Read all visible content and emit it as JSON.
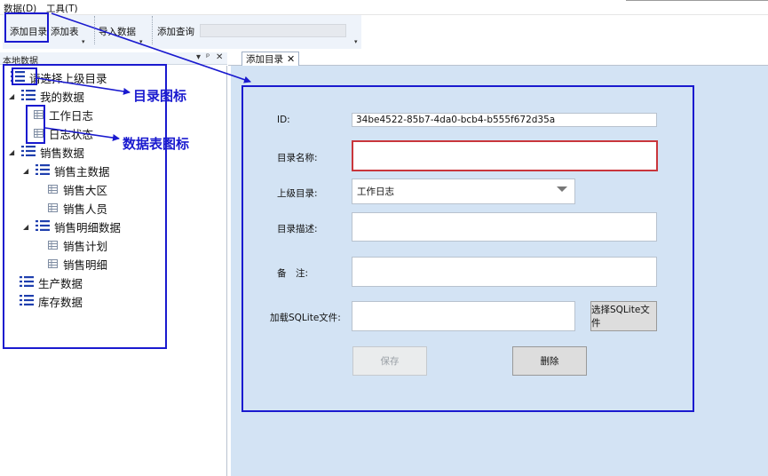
{
  "menu": {
    "items": [
      "数据(D)",
      "工具(T)"
    ]
  },
  "toolbar": {
    "add_directory": "添加目录",
    "add_table": "添加表",
    "import_data": "导入数据",
    "add_query": "添加查询"
  },
  "left_panel": {
    "title": "本地数据",
    "controls": [
      "▾",
      "ᵖ",
      "✕"
    ],
    "tree": {
      "root": "请选择上级目录",
      "my_data": "我的数据",
      "work_log": "工作日志",
      "log_status": "日志状态",
      "sales_data": "销售数据",
      "sales_master": "销售主数据",
      "sales_region": "销售大区",
      "sales_staff": "销售人员",
      "sales_detail_data": "销售明细数据",
      "sales_plan": "销售计划",
      "sales_detail": "销售明细",
      "production_data": "生产数据",
      "inventory_data": "库存数据"
    }
  },
  "annotations": {
    "directory_icon": "目录图标",
    "table_icon": "数据表图标"
  },
  "tab": {
    "label": "添加目录",
    "close": "✕"
  },
  "form": {
    "id_label": "ID:",
    "id_value": "34be4522-85b7-4da0-bcb4-b555f672d35a",
    "name_label": "目录名称:",
    "name_value": "",
    "parent_label": "上级目录:",
    "parent_value": "工作日志",
    "desc_label": "目录描述:",
    "desc_value": "",
    "note_label": "备　注:",
    "note_value": "",
    "sqlite_label": "加载SQLite文件:",
    "sqlite_value": "",
    "choose_sqlite": "选择SQLite文件",
    "save": "保存",
    "delete": "删除"
  },
  "colors": {
    "annotation": "#1a1acf",
    "content_bg": "#d3e3f4",
    "error_border": "#c9363c",
    "tree_icon": "#1f3fae"
  },
  "icons": {
    "directory": "list-icon",
    "table": "grid-icon"
  }
}
